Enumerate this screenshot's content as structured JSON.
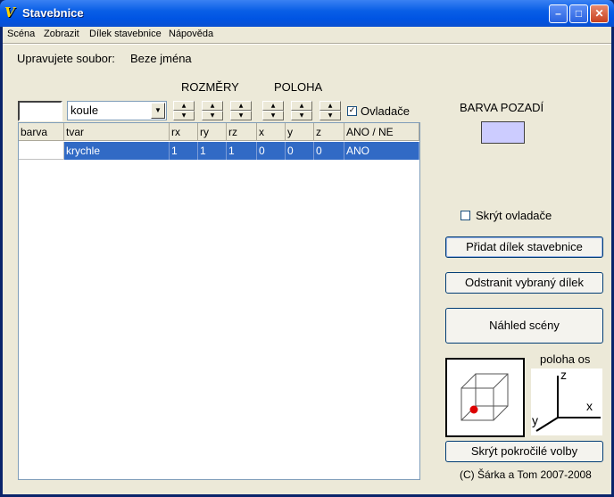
{
  "window": {
    "title": "Stavebnice",
    "app_icon": "app-logo-icon",
    "controls": [
      "minimize-icon",
      "maximize-icon",
      "close-icon"
    ]
  },
  "menu": [
    "Scéna",
    "Zobrazit",
    "Dílek stavebnice",
    "Nápověda"
  ],
  "file": {
    "label": "Upravujete soubor:",
    "name": "Beze jména"
  },
  "headings": {
    "dimensions": "ROZMĚRY",
    "position": "POLOHA",
    "background_color": "BARVA POZADÍ",
    "axes_position": "poloha os"
  },
  "shape_select": {
    "value": "koule"
  },
  "controls_checkbox": {
    "label": "Ovladače",
    "checked": true
  },
  "hide_controls_checkbox": {
    "label": "Skrýt ovladače",
    "checked": false
  },
  "table": {
    "columns": [
      "barva",
      "tvar",
      "rx",
      "ry",
      "rz",
      "x",
      "y",
      "z",
      "ANO / NE"
    ],
    "rows": [
      {
        "barva": "",
        "tvar": "krychle",
        "rx": "1",
        "ry": "1",
        "rz": "1",
        "x": "0",
        "y": "0",
        "z": "0",
        "visible": "ANO"
      }
    ]
  },
  "buttons": {
    "add_part": "Přidat dílek stavebnice",
    "remove_part": "Odstranit vybraný dílek",
    "preview": "Náhled scény",
    "hide_advanced": "Skrýt pokročilé volby"
  },
  "axes": {
    "z": "z",
    "x": "x",
    "y": "y"
  },
  "copyright": "(C) Šárka a Tom 2007-2008",
  "colors": {
    "background_swatch": "#ccccff",
    "selection": "#316ac5",
    "titlebar": "#0054e3"
  }
}
